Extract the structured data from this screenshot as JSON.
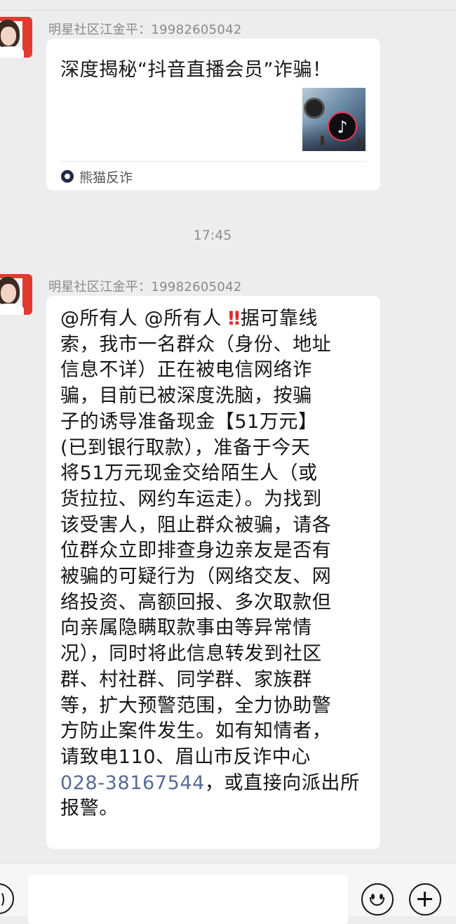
{
  "messages": [
    {
      "sender": "明星社区江金平：19982605042",
      "card": {
        "title": "深度揭秘“抖音直播会员”诈骗！",
        "source": "熊猫反诈",
        "thumbnail_icon": "tiktok-logo-icon"
      }
    },
    {
      "timestamp": "17:45"
    },
    {
      "sender": "明星社区江金平：19982605042",
      "text": {
        "mention1": "@所有人",
        "mention2": "@所有人",
        "emoji": "‼",
        "line_a": "据可靠线",
        "body": "索，我市一名群众（身份、地址\n信息不详）正在被电信网络诈\n骗，目前已被深度洗脑，按骗\n子的诱导准备现金【51万元】\n(已到银行取款），准备于今天\n将51万元现金交给陌生人（或\n货拉拉、网约车运走）。为找到\n该受害人，阻止群众被骗，请各\n位群众立即排查身边亲友是否有\n被骗的可疑行为（网络交友、网\n络投资、高额回报、多次取款但\n向亲属隐瞒取款事由等异常情\n况），同时将此信息转发到社区\n群、村社群、同学群、家族群\n等，扩大预警范围，全力协助警\n方防止案件发生。如有知情者，\n请致电110、眉山市反诈中心\n",
        "phone": "028-38167544",
        "tail": "，或直接向派出所\n报警。"
      }
    }
  ],
  "input_bar": {
    "voice_icon": "voice-icon",
    "emoji_icon": "emoji-icon",
    "plus_icon": "plus-icon"
  },
  "colors": {
    "background": "#ededed",
    "bubble": "#ffffff",
    "link": "#576b95",
    "alert": "#e02a2a"
  }
}
